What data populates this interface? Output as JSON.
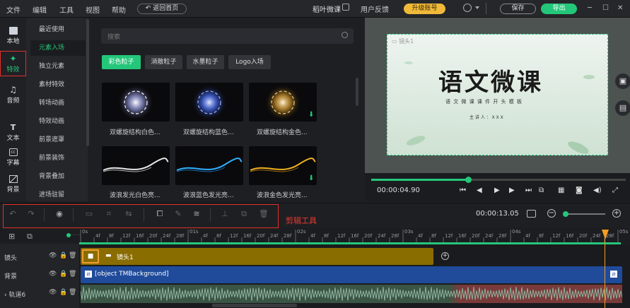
{
  "menu": [
    "文件",
    "编辑",
    "工具",
    "视图",
    "帮助"
  ],
  "top": {
    "back_home": "返回首页",
    "app_title": "稻叶微课",
    "feedback": "用户反馈",
    "upgrade": "升级账号",
    "save": "保存",
    "export": "导出",
    "min": "─",
    "max": "☐",
    "close": "✕"
  },
  "left_sidebar": [
    {
      "label": "本地",
      "icon": "folder-icon"
    },
    {
      "label": "特效",
      "icon": "sparkle-icon"
    },
    {
      "label": "音频",
      "icon": "music-icon"
    },
    {
      "label": "文本",
      "icon": "text-icon"
    },
    {
      "label": "字幕",
      "icon": "subtitle-icon"
    },
    {
      "label": "背景",
      "icon": "background-icon"
    }
  ],
  "categories": [
    "最近使用",
    "元素入场",
    "独立元素",
    "素材特效",
    "转场动画",
    "特效动画",
    "前景遮罩",
    "前景装饰",
    "背景叠加",
    "进场驻留"
  ],
  "search_placeholder": "搜索",
  "subtabs": [
    "彩色粒子",
    "消散粒子",
    "水墨粒子",
    "Logo入场"
  ],
  "effects": [
    {
      "label": "双螺旋结构白色...",
      "color": "#e8e8ff"
    },
    {
      "label": "双螺旋结构蓝色...",
      "color": "#6a8cff"
    },
    {
      "label": "双螺旋结构金色...",
      "color": "#f0c060"
    },
    {
      "label": "波浪发光白色亮...",
      "color": "#ffffff"
    },
    {
      "label": "波浪蓝色发光亮...",
      "color": "#30b0ff"
    },
    {
      "label": "波浪金色发光亮...",
      "color": "#f0b020"
    }
  ],
  "preview": {
    "lens_label": "镜头1",
    "title": "语文微课",
    "subtitle": "语 文 微 课 课 件 开 头 模 板",
    "presenter": "主 讲 人 ： X X X",
    "current_time": "00:00:04.90",
    "progress_fraction": 0.38
  },
  "toolbar": {
    "label": "剪辑工具",
    "total_time": "00:00:13.05"
  },
  "ruler": {
    "ticks": [
      "0s",
      "4f",
      "8f",
      "12f",
      "16f",
      "20f",
      "24f",
      "28f",
      "01s",
      "4f",
      "8f",
      "12f",
      "16f",
      "20f",
      "24f",
      "28f",
      "02s",
      "4f",
      "8f",
      "12f",
      "16f",
      "20f",
      "24f",
      "28f",
      "03s",
      "4f",
      "8f",
      "12f",
      "16f",
      "20f",
      "24f",
      "28f",
      "04s",
      "4f",
      "8f",
      "12f",
      "16f",
      "20f",
      "24f",
      "28f",
      "05s"
    ]
  },
  "tracks": [
    {
      "label": "镜头",
      "clip": "镜头1"
    },
    {
      "label": "背景",
      "clip": "[object TMBackground]"
    },
    {
      "label": "轨道6",
      "clip": ""
    }
  ]
}
